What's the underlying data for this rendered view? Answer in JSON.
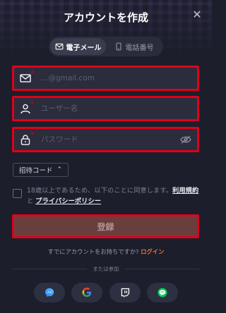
{
  "header": {
    "title": "アカウントを作成",
    "close_label": "✕"
  },
  "tabs": [
    {
      "label": "電子メール",
      "icon": "mail-icon",
      "active": true
    },
    {
      "label": "電話番号",
      "icon": "phone-icon",
      "active": false
    }
  ],
  "form": {
    "email_placeholder": "…@gmail.com",
    "username_placeholder": "ユーザー名",
    "password_placeholder": "パスワード",
    "required_mark": "*"
  },
  "invite": {
    "label": "招待コード",
    "chevron": "⌃"
  },
  "agreement": {
    "text_before": "18歳以上であるため、以下のことに同意します。",
    "terms_link": "利用規約",
    "and": " と ",
    "privacy_link": "プライバシーポリシー"
  },
  "submit_label": "登録",
  "login": {
    "prompt": "すでにアカウントをお持ちですか?",
    "link": "ログイン"
  },
  "divider_text": "または参加",
  "social": [
    "messenger-icon",
    "google-icon",
    "twitch-icon",
    "line-icon"
  ],
  "colors": {
    "background": "#1c1e2c",
    "field_bg": "#2b2d3c",
    "highlight_border": "#e0001a",
    "accent": "#f0742b",
    "submit_bg": "#6b3e3e"
  }
}
